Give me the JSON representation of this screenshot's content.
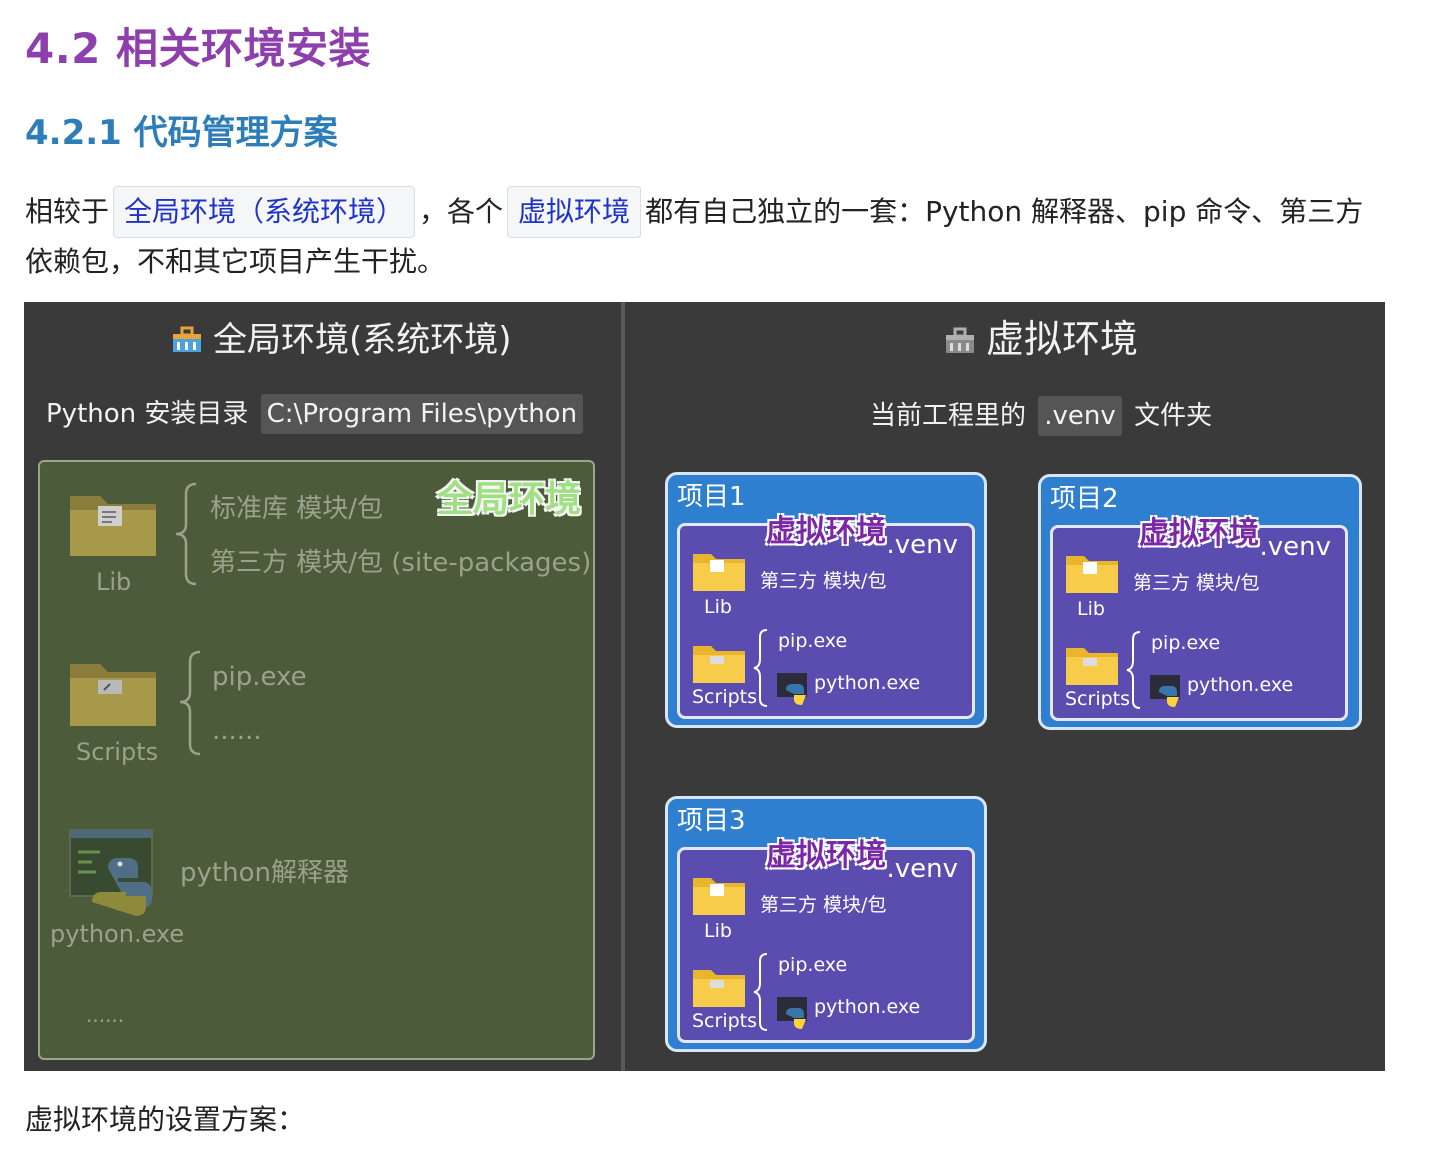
{
  "heading": "4.2 相关环境安装",
  "subheading": "4.2.1 代码管理方案",
  "paragraph": {
    "t1": "相较于",
    "code1": "全局环境（系统环境）",
    "t2": "，各个",
    "code2": "虚拟环境",
    "t3": "都有自己独立的一套：Python 解释器、pip 命令、第三方依赖包，不和其它项目产生干扰。"
  },
  "diagram": {
    "global": {
      "title": "全局环境(系统环境)",
      "dir_label": "Python 安装目录",
      "dir_path": "C:\\Program Files\\python",
      "tag": "全局环境",
      "lib_label": "Lib",
      "lib_item1": "标准库 模块/包",
      "lib_item2": "第三方 模块/包 (site-packages)",
      "scripts_label": "Scripts",
      "scripts_item1": "pip.exe",
      "scripts_item2": "......",
      "python_label": "python.exe",
      "python_desc": "python解释器",
      "more": "......"
    },
    "virtual": {
      "title": "虚拟环境",
      "dir_label": "当前工程里的",
      "dir_path": ".venv",
      "dir_suffix": "文件夹",
      "projects": [
        {
          "title": "项目1",
          "tag": "虚拟环境",
          "venv": ".venv",
          "packages": "第三方 模块/包",
          "lib": "Lib",
          "pip": "pip.exe",
          "python": "python.exe",
          "scripts": "Scripts"
        },
        {
          "title": "项目2",
          "tag": "虚拟环境",
          "venv": ".venv",
          "packages": "第三方 模块/包",
          "lib": "Lib",
          "pip": "pip.exe",
          "python": "python.exe",
          "scripts": "Scripts"
        },
        {
          "title": "项目3",
          "tag": "虚拟环境",
          "venv": ".venv",
          "packages": "第三方 模块/包",
          "lib": "Lib",
          "pip": "pip.exe",
          "python": "python.exe",
          "scripts": "Scripts"
        }
      ]
    },
    "icons": [
      "folder-icon",
      "python-icon",
      "toolbox-icon"
    ],
    "colors": {
      "global_bg": "#4c5b39",
      "project_bg": "#2f7fd0",
      "venv_bg": "#5b4db0",
      "tag_purple": "#7a27a8",
      "tag_green": "#9fe082"
    }
  },
  "footer": "虚拟环境的设置方案："
}
